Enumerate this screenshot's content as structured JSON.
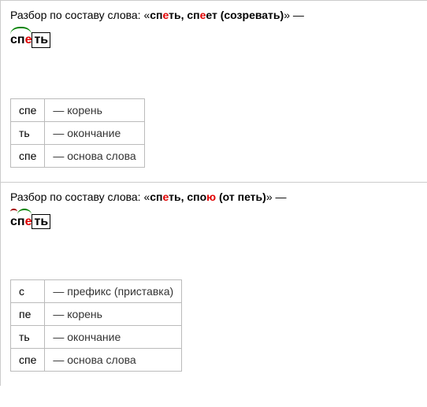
{
  "section1": {
    "intro": "Разбор по составу слова: «",
    "word_p1": "сп",
    "word_e1": "е",
    "word_p2": "ть, сп",
    "word_e2": "е",
    "word_p3": "ет (созревать)",
    "close": "» —",
    "morph": {
      "root_pre": "сп",
      "root_stress": "е",
      "ending": "ть"
    },
    "rows": [
      {
        "m": "спе",
        "d": "— корень"
      },
      {
        "m": "ть",
        "d": "— окончание"
      },
      {
        "m": "спе",
        "d": "— основа слова"
      }
    ]
  },
  "section2": {
    "intro": "Разбор по составу слова: «",
    "word_p1": "сп",
    "word_e1": "е",
    "word_p2": "ть, спо",
    "word_e2": "ю",
    "word_p3": " (от петь)",
    "close": "» —",
    "morph": {
      "prefix": "с",
      "root_pre": "п",
      "root_stress": "е",
      "ending": "ть"
    },
    "rows": [
      {
        "m": "с",
        "d": "— префикс (приставка)"
      },
      {
        "m": "пе",
        "d": "— корень"
      },
      {
        "m": "ть",
        "d": "— окончание"
      },
      {
        "m": "спе",
        "d": "— основа слова"
      }
    ]
  }
}
